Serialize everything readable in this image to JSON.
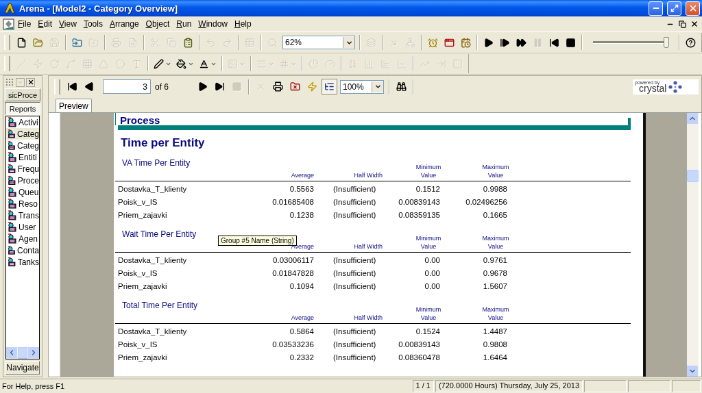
{
  "window": {
    "title": "Arena - [Model2 - Category Overview]"
  },
  "menu": [
    {
      "label": "File"
    },
    {
      "label": "Edit"
    },
    {
      "label": "View"
    },
    {
      "label": "Tools"
    },
    {
      "label": "Arrange"
    },
    {
      "label": "Object"
    },
    {
      "label": "Run"
    },
    {
      "label": "Window"
    },
    {
      "label": "Help"
    }
  ],
  "toolbars": [
    {
      "items": [
        {
          "kind": "new",
          "disabled": false
        },
        {
          "kind": "open",
          "disabled": false
        },
        {
          "kind": "save",
          "disabled": true
        },
        {
          "kind": "separator"
        },
        {
          "kind": "template",
          "disabled": false
        },
        {
          "kind": "export",
          "disabled": true
        },
        {
          "kind": "separator"
        },
        {
          "kind": "print",
          "disabled": true
        },
        {
          "kind": "preview",
          "disabled": true
        },
        {
          "kind": "separator"
        },
        {
          "kind": "cut",
          "disabled": true
        },
        {
          "kind": "copy",
          "disabled": true
        },
        {
          "kind": "paste",
          "disabled": false
        },
        {
          "kind": "separator"
        },
        {
          "kind": "undo",
          "disabled": true
        },
        {
          "kind": "redo",
          "disabled": true
        },
        {
          "kind": "separator"
        },
        {
          "kind": "layout",
          "disabled": true
        },
        {
          "kind": "separator"
        },
        {
          "kind": "zoom",
          "disabled": true
        },
        {
          "kind": "combo",
          "value": "62%"
        },
        {
          "kind": "separator"
        },
        {
          "kind": "layers",
          "disabled": true
        },
        {
          "kind": "separator"
        },
        {
          "kind": "drop",
          "disabled": true
        },
        {
          "kind": "connect",
          "disabled": true
        },
        {
          "kind": "separator"
        },
        {
          "kind": "clock",
          "disabled": false
        },
        {
          "kind": "breakpoint",
          "disabled": false
        },
        {
          "kind": "timewindow",
          "disabled": false
        },
        {
          "kind": "separator"
        },
        {
          "kind": "play",
          "disabled": false
        },
        {
          "kind": "step",
          "disabled": false
        },
        {
          "kind": "fast",
          "disabled": false
        },
        {
          "kind": "pause",
          "disabled": true
        },
        {
          "kind": "start",
          "disabled": false
        },
        {
          "kind": "stop",
          "disabled": false
        },
        {
          "kind": "separator"
        },
        {
          "kind": "slider",
          "level": 0.98
        },
        {
          "kind": "separator"
        },
        {
          "kind": "help",
          "disabled": false
        }
      ]
    },
    {
      "items": [
        {
          "kind": "line",
          "disabled": true
        },
        {
          "kind": "polyline",
          "disabled": true
        },
        {
          "kind": "arc",
          "disabled": true
        },
        {
          "kind": "bezier",
          "disabled": true
        },
        {
          "kind": "box",
          "disabled": true
        },
        {
          "kind": "polygon",
          "disabled": true
        },
        {
          "kind": "ellipse",
          "disabled": true
        },
        {
          "kind": "text",
          "disabled": true
        },
        {
          "kind": "separator"
        },
        {
          "kind": "linecolor",
          "disabled": false
        },
        {
          "kind": "fillcolor",
          "disabled": false
        },
        {
          "kind": "textcolor",
          "disabled": false
        },
        {
          "kind": "separator"
        },
        {
          "kind": "picture",
          "disabled": true
        },
        {
          "kind": "separator"
        },
        {
          "kind": "linestyle",
          "disabled": true
        },
        {
          "kind": "pattern",
          "disabled": true
        },
        {
          "kind": "separator"
        },
        {
          "kind": "clockchart",
          "disabled": true
        },
        {
          "kind": "gauge",
          "disabled": true
        },
        {
          "kind": "separator"
        },
        {
          "kind": "number",
          "disabled": true
        },
        {
          "kind": "level",
          "disabled": true
        },
        {
          "kind": "histogram",
          "disabled": true
        },
        {
          "kind": "plot",
          "disabled": true
        },
        {
          "kind": "separator"
        },
        {
          "kind": "transfer",
          "disabled": true
        },
        {
          "kind": "route",
          "disabled": true
        },
        {
          "kind": "block",
          "disabled": true
        }
      ]
    }
  ],
  "project_bar": {
    "panels": [
      {
        "label": "sicProce",
        "selected": false
      },
      {
        "label": "Reports",
        "selected": true
      }
    ],
    "items": [
      {
        "label": "Activi",
        "selected": false
      },
      {
        "label": "Categ",
        "selected": true
      },
      {
        "label": "Categ",
        "selected": false
      },
      {
        "label": "Entiti",
        "selected": false
      },
      {
        "label": "Frequ",
        "selected": false
      },
      {
        "label": "Proce",
        "selected": false
      },
      {
        "label": "Queu",
        "selected": false
      },
      {
        "label": "Reso",
        "selected": false
      },
      {
        "label": "Trans",
        "selected": false
      },
      {
        "label": "User",
        "selected": false
      },
      {
        "label": "Agen",
        "selected": false
      },
      {
        "label": "Conta",
        "selected": false
      },
      {
        "label": "Tanks",
        "selected": false
      }
    ],
    "footer": "Navigate"
  },
  "viewer": {
    "toolbar": [
      {
        "kind": "first",
        "disabled": false
      },
      {
        "kind": "prev",
        "disabled": false
      },
      {
        "kind": "page",
        "value": "3",
        "total": "of 6"
      },
      {
        "kind": "next",
        "disabled": false
      },
      {
        "kind": "last",
        "disabled": false
      },
      {
        "kind": "stopload",
        "disabled": true
      },
      {
        "kind": "separator"
      },
      {
        "kind": "close",
        "disabled": true
      },
      {
        "kind": "print",
        "disabled": false
      },
      {
        "kind": "export",
        "disabled": false
      },
      {
        "kind": "refresh",
        "disabled": false
      },
      {
        "kind": "tree",
        "disabled": false
      },
      {
        "kind": "combo",
        "value": "100%"
      },
      {
        "kind": "separator"
      },
      {
        "kind": "find",
        "disabled": false
      },
      {
        "kind": "separator"
      }
    ],
    "logo": {
      "tagline": "powered by",
      "name": "crystal"
    },
    "tabs": [
      {
        "label": "Preview",
        "selected": true
      }
    ]
  },
  "report": {
    "banner": "Process",
    "title": "Time per Entity",
    "tooltip": "Group #5 Name (String)",
    "sections": [
      {
        "title": "VA Time Per Entity",
        "columns": [
          "Average",
          "Half Width",
          "Minimum Value",
          "Maximum Value"
        ],
        "rows": [
          {
            "name": "Dostavka_T_klienty",
            "cells": [
              "0.5563",
              "(Insufficient)",
              "0.1512",
              "0.9988"
            ]
          },
          {
            "name": "Poisk_v_IS",
            "cells": [
              "0.01685408",
              "(Insufficient)",
              "0.00839143",
              "0.02496256"
            ]
          },
          {
            "name": "Priem_zajavki",
            "cells": [
              "0.1238",
              "(Insufficient)",
              "0.08359135",
              "0.1665"
            ]
          }
        ]
      },
      {
        "title": "Wait Time Per Entity",
        "columns": [
          "Average",
          "Half Width",
          "Minimum Value",
          "Maximum Value"
        ],
        "rows": [
          {
            "name": "Dostavka_T_klienty",
            "cells": [
              "0.03006117",
              "(Insufficient)",
              "0.00",
              "0.9761"
            ]
          },
          {
            "name": "Poisk_v_IS",
            "cells": [
              "0.01847828",
              "(Insufficient)",
              "0.00",
              "0.9678"
            ]
          },
          {
            "name": "Priem_zajavki",
            "cells": [
              "0.1094",
              "(Insufficient)",
              "0.00",
              "1.5607"
            ]
          }
        ]
      },
      {
        "title": "Total Time Per Entity",
        "columns": [
          "Average",
          "Half Width",
          "Minimum Value",
          "Maximum Value"
        ],
        "rows": [
          {
            "name": "Dostavka_T_klienty",
            "cells": [
              "0.5864",
              "(Insufficient)",
              "0.1524",
              "1.4487"
            ]
          },
          {
            "name": "Poisk_v_IS",
            "cells": [
              "0.03533236",
              "(Insufficient)",
              "0.00839143",
              "0.9808"
            ]
          },
          {
            "name": "Priem_zajavki",
            "cells": [
              "0.2332",
              "(Insufficient)",
              "0.08360478",
              "1.6464"
            ]
          }
        ]
      }
    ]
  },
  "status_bar": {
    "help": "For Help, press F1",
    "panes": [
      "1 / 1",
      "(720.0000 Hours) Thursday, July 25, 2013"
    ]
  }
}
